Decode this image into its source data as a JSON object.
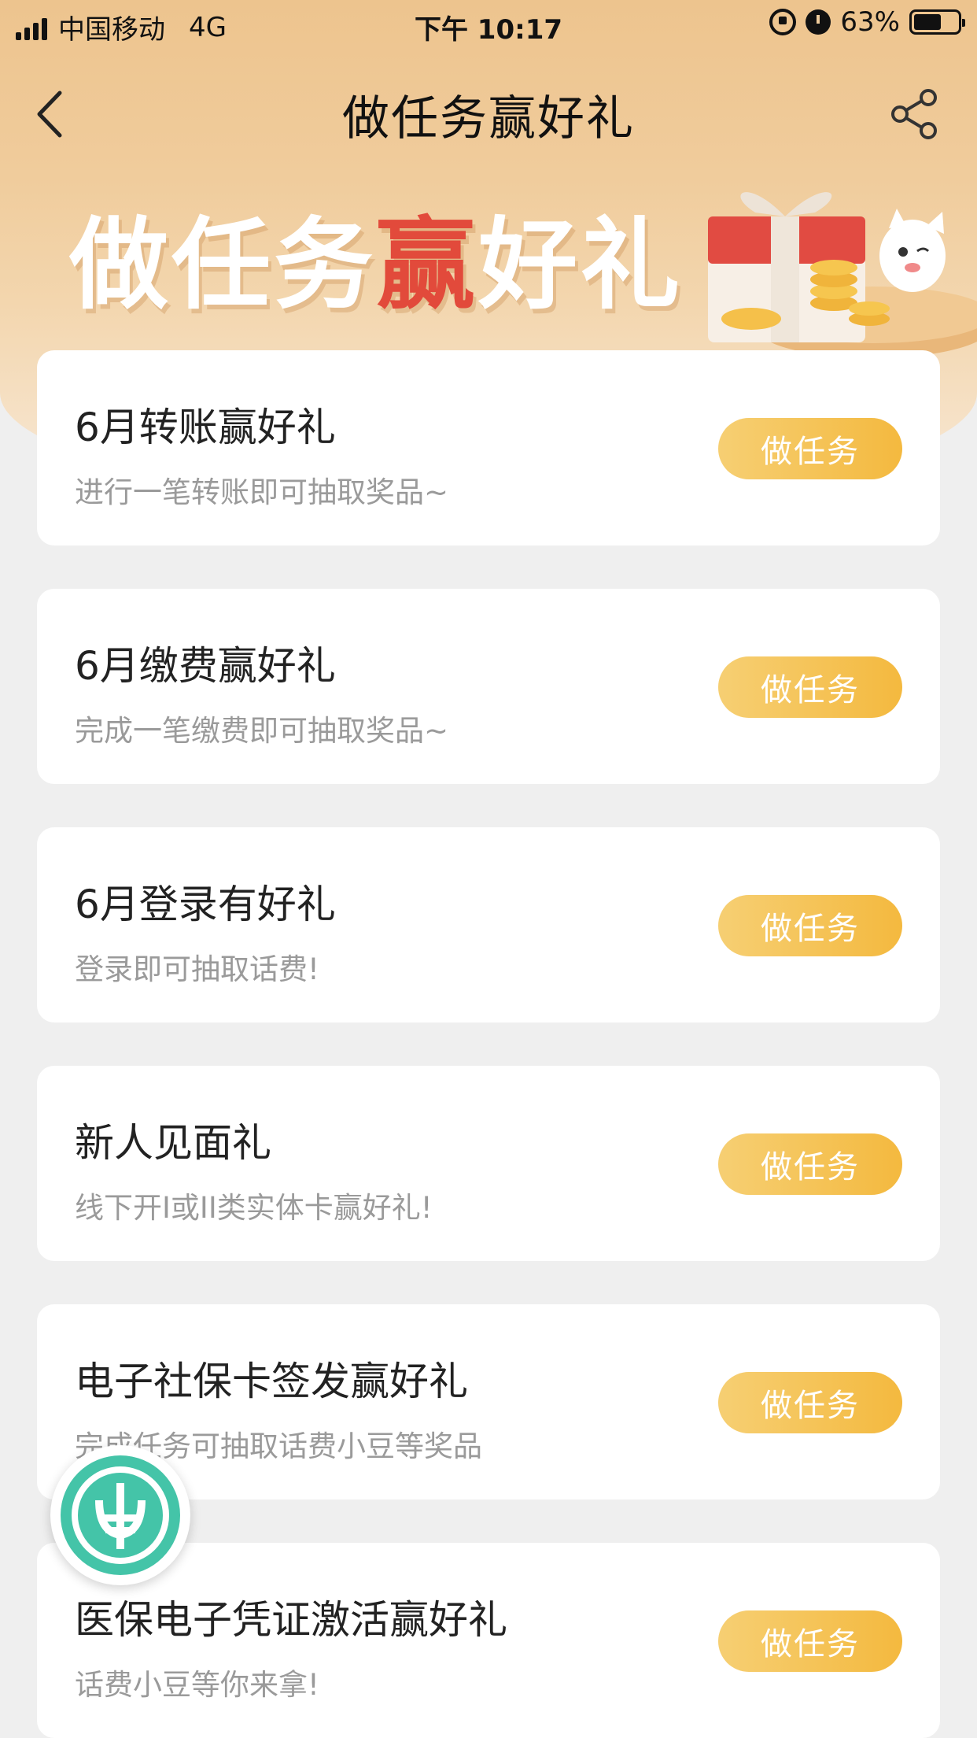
{
  "status_bar": {
    "carrier": "中国移动",
    "network": "4G",
    "time": "下午 10:17",
    "battery": "63%",
    "battery_level": 0.63
  },
  "nav": {
    "title": "做任务赢好礼"
  },
  "banner": {
    "title_part1": "做任务",
    "title_highlight": "赢",
    "title_part2": "好礼"
  },
  "tasks": [
    {
      "title": "6月转账赢好礼",
      "desc": "进行一笔转账即可抽取奖品~",
      "button": "做任务"
    },
    {
      "title": "6月缴费赢好礼",
      "desc": "完成一笔缴费即可抽取奖品~",
      "button": "做任务"
    },
    {
      "title": "6月登录有好礼",
      "desc": "登录即可抽取话费!",
      "button": "做任务"
    },
    {
      "title": "新人见面礼",
      "desc": "线下开I或II类实体卡赢好礼!",
      "button": "做任务"
    },
    {
      "title": "电子社保卡签发赢好礼",
      "desc": "完成任务可抽取话费小豆等奖品",
      "button": "做任务"
    },
    {
      "title": "医保电子凭证激活赢好礼",
      "desc": "话费小豆等你来拿!",
      "button": "做任务"
    }
  ],
  "colors": {
    "accent": "#f4b93f",
    "header_bg": "#edc48e",
    "badge": "#3fbfa3",
    "highlight": "#e24a3b"
  },
  "icons": {
    "back": "chevron-left-icon",
    "share": "share-icon",
    "badge": "abc-bank-logo-icon"
  }
}
